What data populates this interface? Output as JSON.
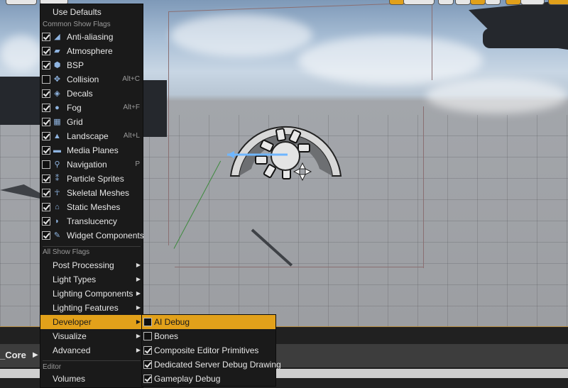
{
  "viewport": {
    "toolbar_buttons": [
      "view-mode",
      "show-flags",
      "transform-1",
      "transform-2",
      "snap-1",
      "snap-2",
      "snap-3",
      "snap-4",
      "camera-speed"
    ]
  },
  "colors": {
    "accent": "#e2a11a",
    "menu_bg": "#1a1a1a",
    "menu_text": "#e6e6e6",
    "section_text": "#9a9a9a"
  },
  "show_menu": {
    "use_defaults": "Use Defaults",
    "common_section": "Common Show Flags",
    "common_flags": [
      {
        "label": "Anti-aliasing",
        "checked": true,
        "icon": "anti-aliasing-icon",
        "glyph": "◢",
        "shortcut": ""
      },
      {
        "label": "Atmosphere",
        "checked": true,
        "icon": "atmosphere-icon",
        "glyph": "▰",
        "shortcut": ""
      },
      {
        "label": "BSP",
        "checked": true,
        "icon": "bsp-icon",
        "glyph": "⬢",
        "shortcut": ""
      },
      {
        "label": "Collision",
        "checked": false,
        "icon": "collision-icon",
        "glyph": "✥",
        "shortcut": "Alt+C"
      },
      {
        "label": "Decals",
        "checked": true,
        "icon": "decals-icon",
        "glyph": "◈",
        "shortcut": ""
      },
      {
        "label": "Fog",
        "checked": true,
        "icon": "fog-icon",
        "glyph": "●",
        "shortcut": "Alt+F"
      },
      {
        "label": "Grid",
        "checked": true,
        "icon": "grid-icon",
        "glyph": "▦",
        "shortcut": ""
      },
      {
        "label": "Landscape",
        "checked": true,
        "icon": "landscape-icon",
        "glyph": "▲",
        "shortcut": "Alt+L"
      },
      {
        "label": "Media Planes",
        "checked": true,
        "icon": "media-planes-icon",
        "glyph": "▬",
        "shortcut": ""
      },
      {
        "label": "Navigation",
        "checked": false,
        "icon": "navigation-icon",
        "glyph": "⚲",
        "shortcut": "P"
      },
      {
        "label": "Particle Sprites",
        "checked": true,
        "icon": "particle-sprites-icon",
        "glyph": "⁑",
        "shortcut": ""
      },
      {
        "label": "Skeletal Meshes",
        "checked": true,
        "icon": "skeletal-meshes-icon",
        "glyph": "☥",
        "shortcut": ""
      },
      {
        "label": "Static Meshes",
        "checked": true,
        "icon": "static-meshes-icon",
        "glyph": "⌂",
        "shortcut": ""
      },
      {
        "label": "Translucency",
        "checked": true,
        "icon": "translucency-icon",
        "glyph": "◗",
        "shortcut": ""
      },
      {
        "label": "Widget Components",
        "checked": true,
        "icon": "widget-components-icon",
        "glyph": "✎",
        "shortcut": ""
      }
    ],
    "all_section": "All Show Flags",
    "all_flags": [
      {
        "label": "Post Processing",
        "highlighted": false
      },
      {
        "label": "Light Types",
        "highlighted": false
      },
      {
        "label": "Lighting Components",
        "highlighted": false
      },
      {
        "label": "Lighting Features",
        "highlighted": false
      },
      {
        "label": "Developer",
        "highlighted": true
      },
      {
        "label": "Visualize",
        "highlighted": false
      },
      {
        "label": "Advanced",
        "highlighted": false
      }
    ],
    "editor_section": "Editor",
    "editor_items": [
      {
        "label": "Volumes"
      }
    ]
  },
  "developer_submenu": {
    "items": [
      {
        "label": "AI Debug",
        "checked": false,
        "highlighted": true
      },
      {
        "label": "Bones",
        "checked": false,
        "highlighted": false
      },
      {
        "label": "Composite Editor Primitives",
        "checked": true,
        "highlighted": false
      },
      {
        "label": "Dedicated Server Debug Drawing",
        "checked": true,
        "highlighted": false
      },
      {
        "label": "Gameplay Debug",
        "checked": true,
        "highlighted": false
      }
    ]
  },
  "bottom_panel": {
    "label": "_Core",
    "arrow": "▶"
  }
}
